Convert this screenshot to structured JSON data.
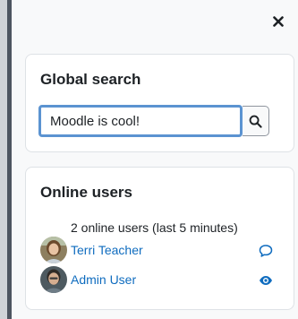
{
  "global_search": {
    "title": "Global search",
    "input_value": "Moodle is cool!",
    "search_icon": "magnifier-icon"
  },
  "online_users": {
    "title": "Online users",
    "summary": "2 online users (last 5 minutes)",
    "users": [
      {
        "name": "Terri Teacher",
        "action_icon": "message-icon"
      },
      {
        "name": "Admin User",
        "action_icon": "eye-icon"
      }
    ]
  },
  "drawer": {
    "close_icon": "close-icon"
  },
  "colors": {
    "link": "#0f6cbf",
    "input_focus": "#5b93d1",
    "background": "#f8f9fa"
  }
}
